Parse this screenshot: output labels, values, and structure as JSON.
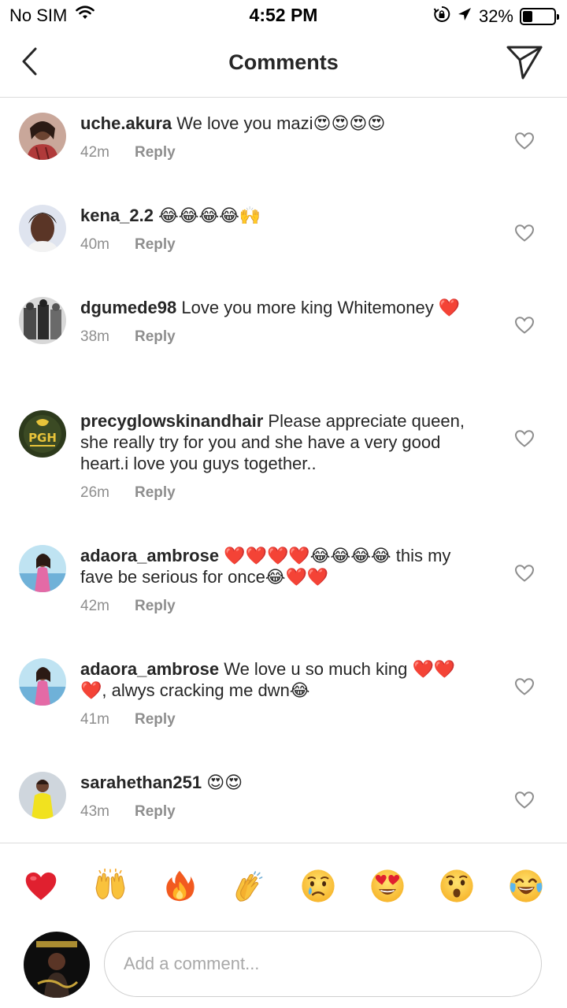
{
  "status_bar": {
    "carrier": "No SIM",
    "time": "4:52 PM",
    "battery_text": "32%",
    "battery_level": 0.32
  },
  "header": {
    "title": "Comments",
    "back_icon": "chevron-left-icon",
    "send_icon": "paper-plane-icon"
  },
  "comments": [
    {
      "username": "uche.akura",
      "text": "We love you mazi😍😍😍😍",
      "time": "42m",
      "reply": "Reply"
    },
    {
      "username": "kena_2.2",
      "text": "😂😂😂😂🙌",
      "time": "40m",
      "reply": "Reply"
    },
    {
      "username": "dgumede98",
      "text": "Love you more king Whitemoney ❤️",
      "time": "38m",
      "reply": "Reply"
    },
    {
      "username": "precyglowskinandhair",
      "text": "Please appreciate queen, she really  try for you and she have a very good heart.i love you guys together..",
      "time": "26m",
      "reply": "Reply"
    },
    {
      "username": "adaora_ambrose",
      "text": "❤️❤️❤️❤️😂😂😂😂 this my fave be serious for once😂❤️❤️",
      "time": "42m",
      "reply": "Reply"
    },
    {
      "username": "adaora_ambrose",
      "text": "We love u so much king ❤️❤️❤️, alwys cracking me dwn😂",
      "time": "41m",
      "reply": "Reply"
    },
    {
      "username": "sarahethan251",
      "text": "😍😍",
      "time": "43m",
      "reply": "Reply"
    }
  ],
  "quick_reactions": [
    "red-heart",
    "raising-hands",
    "fire",
    "clapping-hands",
    "crying-face",
    "heart-eyes",
    "surprised-face",
    "tears-of-joy"
  ],
  "composer": {
    "placeholder": "Add a comment..."
  },
  "colors": {
    "text": "#262626",
    "meta": "#8e8e8e",
    "divider": "#dbdbdb",
    "heart": "#e0245e"
  }
}
